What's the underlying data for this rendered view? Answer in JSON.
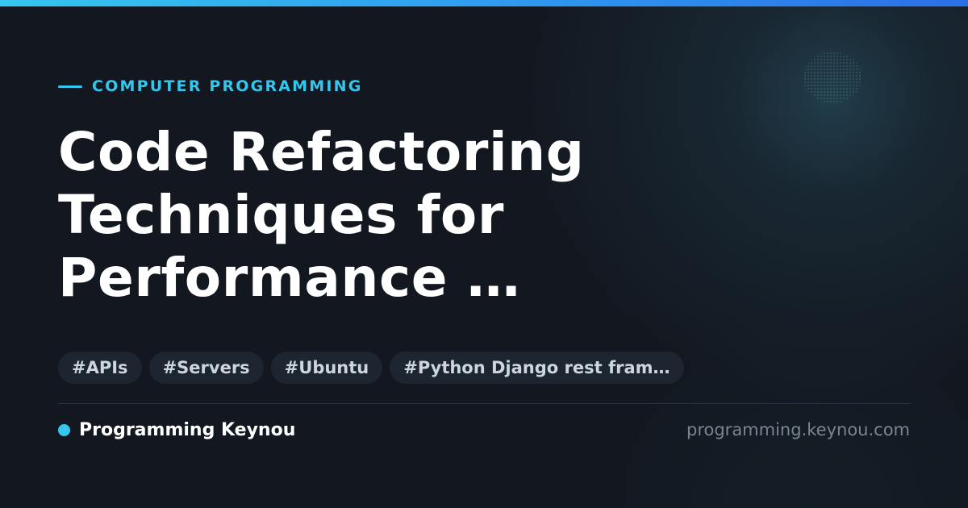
{
  "category": "COMPUTER PROGRAMMING",
  "title_lines": [
    "Code Refactoring",
    "Techniques for",
    "Performance …"
  ],
  "tags": [
    "#APIs",
    "#Servers",
    "#Ubuntu",
    "#Python Django rest fram…"
  ],
  "brand": {
    "name": "Programming Keynou",
    "url": "programming.keynou.com"
  },
  "colors": {
    "accent": "#35c6ee",
    "background": "#131820",
    "tag_background": "#1d2630",
    "title": "#ffffff",
    "muted": "#7a8590"
  }
}
